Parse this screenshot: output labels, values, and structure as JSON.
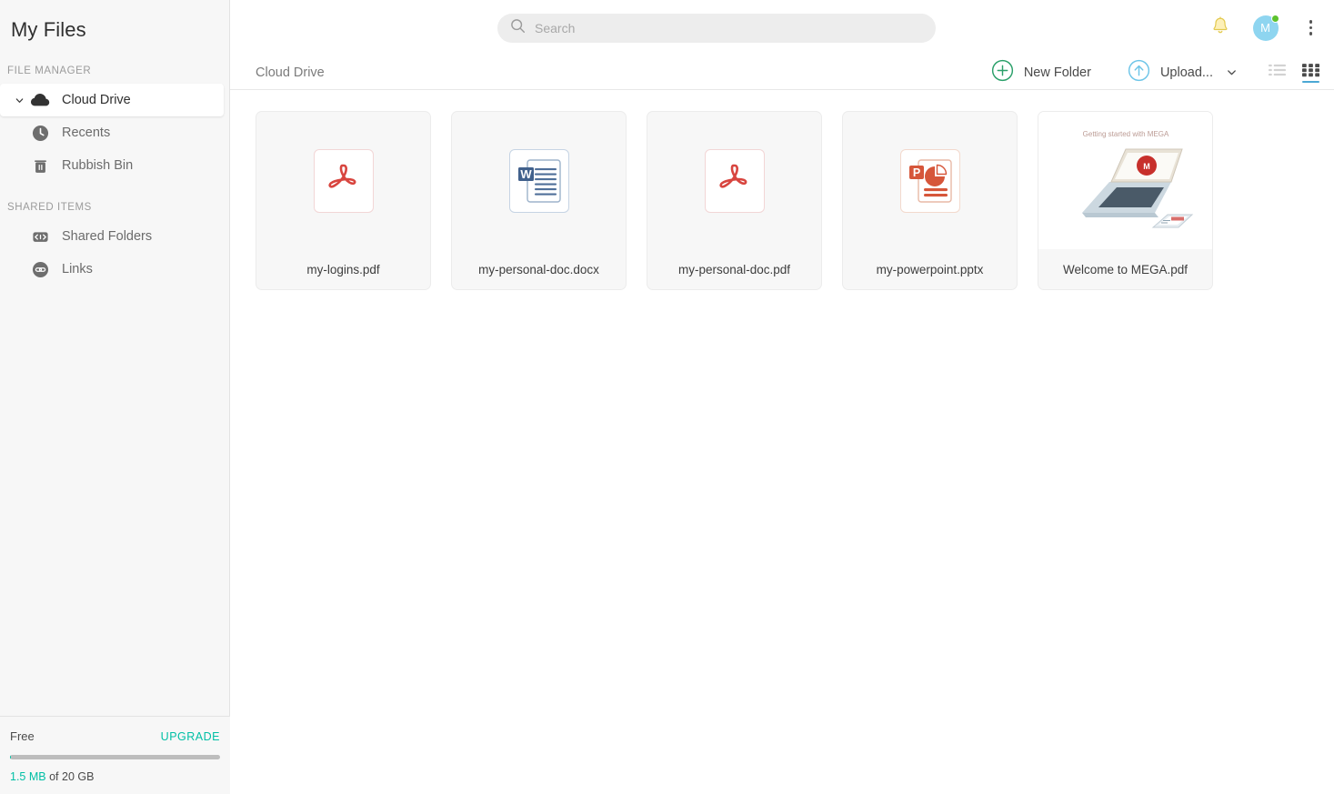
{
  "sidebar": {
    "title": "My Files",
    "sections": [
      {
        "label": "FILE MANAGER",
        "items": [
          {
            "label": "Cloud Drive",
            "icon": "cloud-icon",
            "active": true,
            "expandable": true
          },
          {
            "label": "Recents",
            "icon": "clock-icon",
            "active": false,
            "expandable": false
          },
          {
            "label": "Rubbish Bin",
            "icon": "trash-icon",
            "active": false,
            "expandable": false
          }
        ]
      },
      {
        "label": "SHARED ITEMS",
        "items": [
          {
            "label": "Shared Folders",
            "icon": "shared-folders-icon",
            "active": false,
            "expandable": false
          },
          {
            "label": "Links",
            "icon": "link-icon",
            "active": false,
            "expandable": false
          }
        ]
      }
    ],
    "storage": {
      "plan": "Free",
      "upgrade_label": "UPGRADE",
      "used": "1.5 MB",
      "of_total": "of 20 GB",
      "percent_used": 0.0075
    }
  },
  "topbar": {
    "search": {
      "placeholder": "Search",
      "value": ""
    },
    "notifications_icon": "bell-icon",
    "avatar": {
      "initial": "M",
      "status": "online"
    },
    "menu_icon": "kebab-menu-icon"
  },
  "toolbar": {
    "breadcrumb": "Cloud Drive",
    "new_folder_label": "New Folder",
    "upload_label": "Upload...",
    "list_view_label": "List view",
    "grid_view_label": "Grid view",
    "active_view": "grid"
  },
  "files": [
    {
      "name": "my-logins.pdf",
      "type": "pdf"
    },
    {
      "name": "my-personal-doc.docx",
      "type": "docx"
    },
    {
      "name": "my-personal-doc.pdf",
      "type": "pdf"
    },
    {
      "name": "my-powerpoint.pptx",
      "type": "pptx"
    },
    {
      "name": "Welcome to MEGA.pdf",
      "type": "pdf-preview",
      "preview_title": "Getting started with MEGA"
    }
  ],
  "colors": {
    "accent_teal": "#00bfa5",
    "new_folder_green": "#2ba06a",
    "upload_blue": "#6ec5e8",
    "active_view_underline": "#4ba8d4",
    "pdf_red": "#d8453f",
    "word_blue": "#41618c",
    "ppt_orange": "#d6563a",
    "avatar_blue": "#8ed5f0",
    "status_green": "#5dc22d"
  }
}
